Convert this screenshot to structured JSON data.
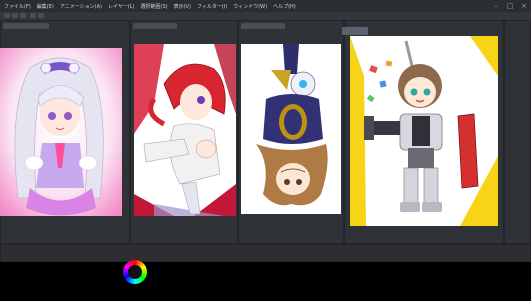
{
  "app": {
    "title": "",
    "menu": [
      "ファイル(F)",
      "編集(E)",
      "アニメーション(A)",
      "レイヤー(L)",
      "選択範囲(S)",
      "表示(V)",
      "フィルター(I)",
      "ウィンドウ(W)",
      "ヘルプ(H)"
    ]
  },
  "canvases": [
    {
      "name": "magical-girl-illustration"
    },
    {
      "name": "red-hair-girl-illustration"
    },
    {
      "name": "upside-down-girl-illustration"
    },
    {
      "name": "chibi-robot-suit-illustration"
    }
  ],
  "colors": {
    "background": "#3a3d42",
    "menubar": "#2b2d31",
    "panel": "#2f3236",
    "yellow_border": "#f7d417"
  }
}
